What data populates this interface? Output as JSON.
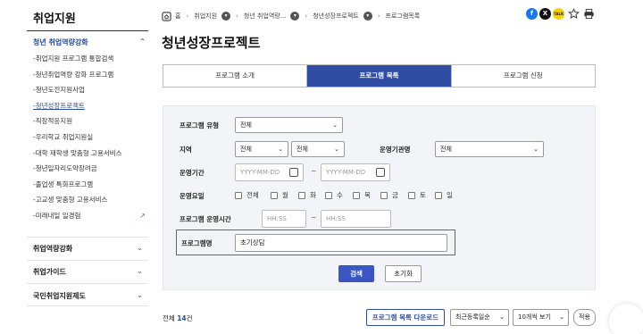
{
  "sidebar": {
    "title": "취업지원",
    "active_section": "청년 취업역량강화",
    "items": [
      "-취업지원 프로그램 통합검색",
      "-청년취업역량 강화 프로그램",
      "-청년도전지원사업",
      "-청년성장프로젝트",
      "-직장적응지원",
      "-우리학교 취업지원실",
      "-대학 재학생 맞춤형 고용서비스",
      "-청년일자리도약장려금",
      "-졸업생 특화프로그램",
      "-고교생 맞춤형 고용서비스",
      "-미래내일 일경험"
    ],
    "current_index": 3,
    "groups": [
      "취업역량강화",
      "취업가이드",
      "국민취업지원제도"
    ]
  },
  "breadcrumb": {
    "home": "홈",
    "items": [
      "취업지원",
      "청년 취업역량...",
      "청년성장프로젝트",
      "프로그램목록"
    ]
  },
  "share": {
    "facebook": "f",
    "x": "X",
    "kakao": "TALK"
  },
  "page_title": "청년성장프로젝트",
  "tabs": [
    "프로그램 소개",
    "프로그램 목록",
    "프로그램 신청"
  ],
  "active_tab": 1,
  "filter": {
    "type_label": "프로그램 유형",
    "type_value": "전체",
    "region_label": "지역",
    "region_value1": "전체",
    "region_value2": "전체",
    "org_label": "운영기관명",
    "org_value": "전체",
    "period_label": "운영기간",
    "date_placeholder": "YYYY-MM-DD",
    "tilde": "~",
    "day_label": "운영요일",
    "days": [
      "전체",
      "월",
      "화",
      "수",
      "목",
      "금",
      "토",
      "일"
    ],
    "time_label": "프로그램 운영시간",
    "time_placeholder": "HH:SS",
    "name_label": "프로그램명",
    "name_value": "초기상담",
    "search_button": "검색",
    "reset_button": "초기화"
  },
  "results": {
    "total_prefix": "전체 ",
    "total_count": "14",
    "total_suffix": "건",
    "download_button": "프로그램 목록 다운로드",
    "sort_value": "최근등록일순",
    "page_size_value": "10개씩 보기",
    "apply_button": "적용"
  },
  "colors": {
    "accent": "#2f4da3",
    "highlight_border": "#dd3333",
    "facebook": "#1877f2",
    "x": "#111111",
    "kakao": "#f7d300"
  }
}
